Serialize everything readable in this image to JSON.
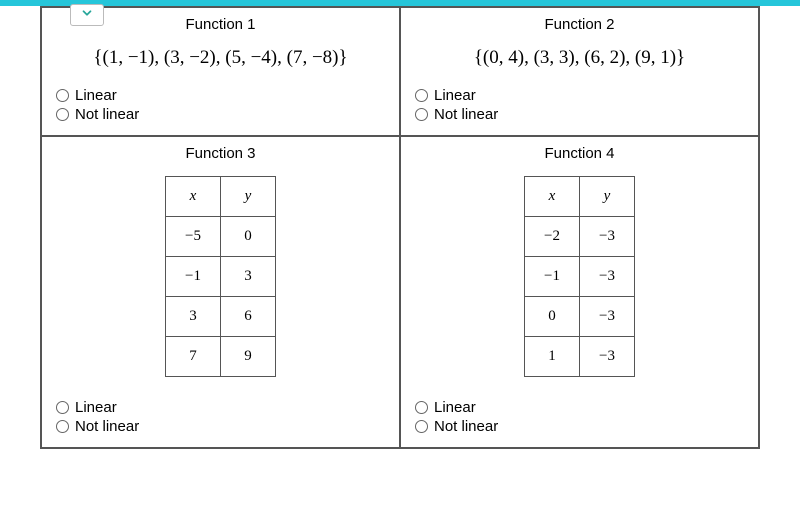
{
  "functions": {
    "f1": {
      "title": "Function 1",
      "set": "{(1, −1), (3, −2), (5, −4), (7, −8)}",
      "options": {
        "linear": "Linear",
        "notlinear": "Not linear"
      }
    },
    "f2": {
      "title": "Function 2",
      "set": "{(0, 4), (3, 3), (6, 2), (9, 1)}",
      "options": {
        "linear": "Linear",
        "notlinear": "Not linear"
      }
    },
    "f3": {
      "title": "Function 3",
      "headers": {
        "x": "x",
        "y": "y"
      },
      "rows": [
        {
          "x": "−5",
          "y": "0"
        },
        {
          "x": "−1",
          "y": "3"
        },
        {
          "x": "3",
          "y": "6"
        },
        {
          "x": "7",
          "y": "9"
        }
      ],
      "options": {
        "linear": "Linear",
        "notlinear": "Not linear"
      }
    },
    "f4": {
      "title": "Function 4",
      "headers": {
        "x": "x",
        "y": "y"
      },
      "rows": [
        {
          "x": "−2",
          "y": "−3"
        },
        {
          "x": "−1",
          "y": "−3"
        },
        {
          "x": "0",
          "y": "−3"
        },
        {
          "x": "1",
          "y": "−3"
        }
      ],
      "options": {
        "linear": "Linear",
        "notlinear": "Not linear"
      }
    }
  }
}
